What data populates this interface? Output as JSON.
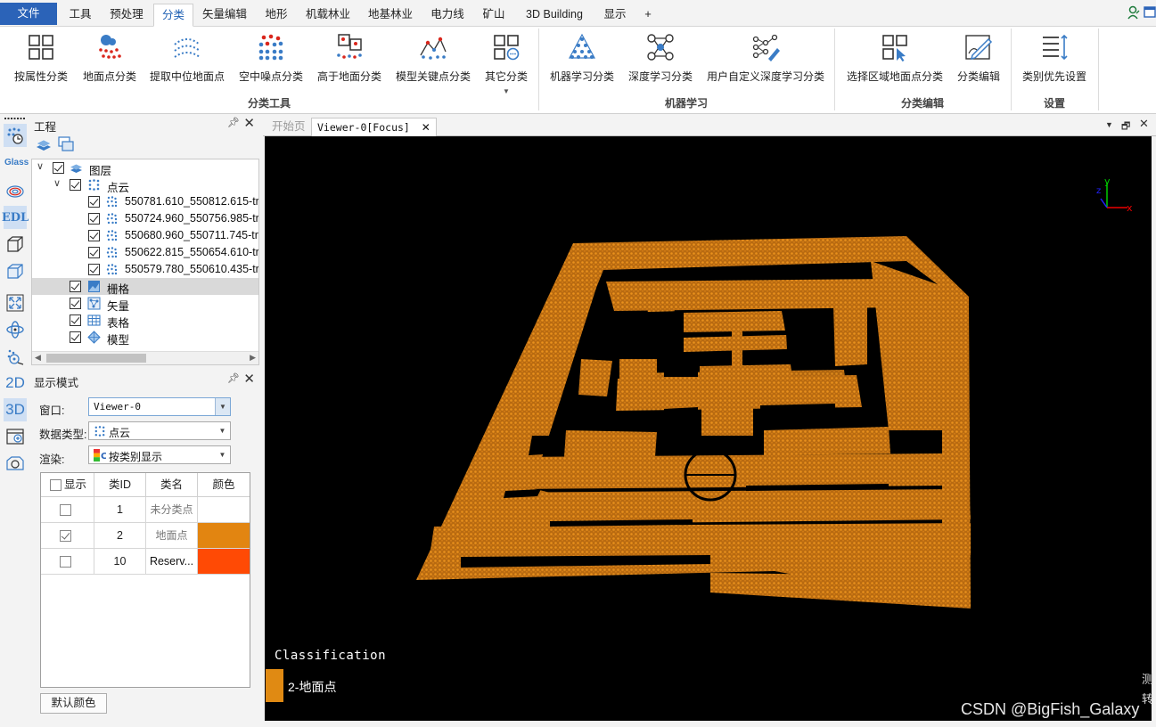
{
  "menu": {
    "file": "文件",
    "tabs": [
      "工具",
      "预处理",
      "分类",
      "矢量编辑",
      "地形",
      "机载林业",
      "地基林业",
      "电力线",
      "矿山",
      "3D Building",
      "显示"
    ],
    "active_tab": "分类",
    "plus": "+"
  },
  "ribbon": {
    "classify_tools": {
      "group_label": "分类工具",
      "buttons": [
        "按属性分类",
        "地面点分类",
        "提取中位地面点",
        "空中噪点分类",
        "高于地面分类",
        "模型关键点分类",
        "其它分类"
      ]
    },
    "machine_learning": {
      "group_label": "机器学习",
      "buttons": [
        "机器学习分类",
        "深度学习分类",
        "用户自定义深度学习分类"
      ]
    },
    "classify_edit": {
      "group_label": "分类编辑",
      "buttons": [
        "选择区域地面点分类",
        "分类编辑"
      ]
    },
    "settings": {
      "group_label": "设置",
      "buttons": [
        "类别优先设置"
      ]
    }
  },
  "left_strip": {
    "glass_label": "Glass",
    "edl_label": "EDL",
    "label_2d": "2D",
    "label_3d": "3D"
  },
  "project_panel": {
    "title": "工程",
    "tree": {
      "root": "图层",
      "pointcloud": "点云",
      "files": [
        "550781.610_550812.615-tr",
        "550724.960_550756.985-tr",
        "550680.960_550711.745-tr",
        "550622.815_550654.610-tr",
        "550579.780_550610.435-tr"
      ],
      "raster": "栅格",
      "vector": "矢量",
      "table": "表格",
      "model": "模型"
    }
  },
  "display_panel": {
    "title": "显示模式",
    "window_label": "窗口:",
    "window_value": "Viewer-0",
    "datatype_label": "数据类型:",
    "datatype_value": "点云",
    "render_label": "渲染:",
    "render_value": "按类别显示",
    "table": {
      "headers": [
        "显示",
        "类ID",
        "类名",
        "颜色"
      ],
      "rows": [
        {
          "checked": false,
          "id": "1",
          "name": "未分类点",
          "color": "#ffffff"
        },
        {
          "checked": true,
          "id": "2",
          "name": "地面点",
          "color": "#e28511"
        },
        {
          "checked": false,
          "id": "10",
          "name": "Reserv...",
          "color": "#ff4a05"
        }
      ]
    },
    "default_color_button": "默认颜色"
  },
  "viewer": {
    "tabs": [
      "开始页",
      "Viewer-0[Focus]"
    ],
    "active_tab": "Viewer-0[Focus]",
    "legend_title": "Classification",
    "legend_item": "2-地面点",
    "legend_color": "#e08a13",
    "point_color": "#cf7a14"
  },
  "watermark": "CSDN @BigFish_Galaxy",
  "side_glyphs": "测转"
}
